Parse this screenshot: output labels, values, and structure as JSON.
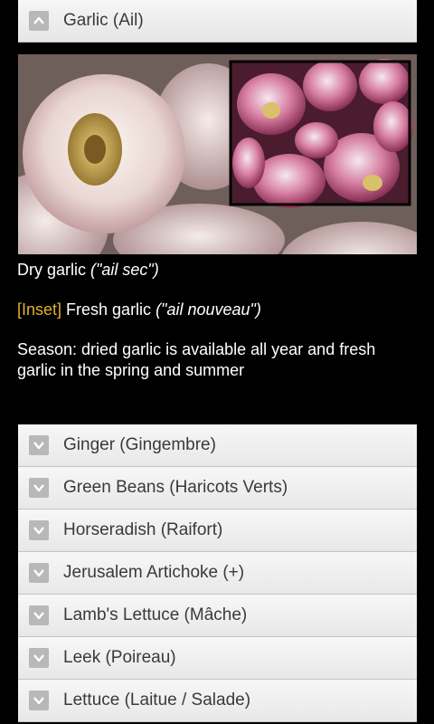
{
  "expanded_item": {
    "label": "Garlic (Ail)",
    "icon": "chevron-up-icon"
  },
  "details": {
    "caption_main": "Dry garlic ",
    "caption_main_italic": "(\"ail sec\")",
    "inset_tag": "[Inset]",
    "inset_text": " Fresh garlic ",
    "inset_italic": "(\"ail nouveau\")",
    "season_line1": "Season: dried garlic is available all year and fresh",
    "season_line2": "garlic in the spring and summer"
  },
  "items": [
    {
      "label": "Ginger (Gingembre)",
      "icon": "chevron-down-icon"
    },
    {
      "label": "Green Beans (Haricots Verts)",
      "icon": "chevron-down-icon"
    },
    {
      "label": "Horseradish (Raifort)",
      "icon": "chevron-down-icon"
    },
    {
      "label": "Jerusalem Artichoke (+)",
      "icon": "chevron-down-icon"
    },
    {
      "label": "Lamb's Lettuce (Mâche)",
      "icon": "chevron-down-icon"
    },
    {
      "label": "Leek (Poireau)",
      "icon": "chevron-down-icon"
    },
    {
      "label": "Lettuce (Laitue / Salade)",
      "icon": "chevron-down-icon"
    }
  ],
  "colors": {
    "background": "#000000",
    "header_bg": "#eeeeee",
    "inset_tag": "#e2b02b"
  }
}
